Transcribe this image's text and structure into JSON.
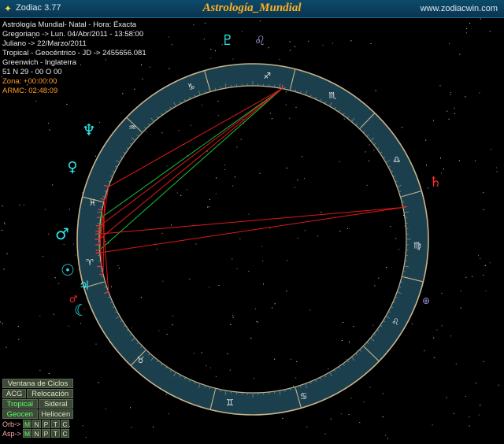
{
  "window": {
    "app_title": "Zodiac 3.77",
    "center_title": "Astrología_Mundial",
    "website": "www.zodiacwin.com"
  },
  "info_lines": [
    "Astrología Mundial- Natal - Hora: Exacta",
    "Gregoriano -> Lun. 04/Abr/2011 - 13:58:00",
    "Juliano -> 22/Marzo/2011",
    "Tropical - Geocéntrico - JD -> 2455656.081",
    "Greenwich - Inglaterra",
    "51 N 29 - 00 O 00",
    "Zona: +00:00:00",
    "ARMC: 02:48:09"
  ],
  "controls": {
    "ventana": "Ventana de Ciclos",
    "acg": "ACG",
    "relocacion": "Relocación",
    "tropical": "Tropical",
    "sideral": "Sideral",
    "geocen": "Geocen",
    "heliocen": "Heliocen",
    "orb_label": "Orb->",
    "asp_label": "Asp->",
    "toggles": [
      "M",
      "N",
      "P",
      "T",
      "C"
    ]
  },
  "signs": [
    {
      "name": "aries",
      "glyph": "♈"
    },
    {
      "name": "taurus",
      "glyph": "♉"
    },
    {
      "name": "gemini",
      "glyph": "♊"
    },
    {
      "name": "cancer",
      "glyph": "♋"
    },
    {
      "name": "leo",
      "glyph": "♌"
    },
    {
      "name": "virgo",
      "glyph": "♍"
    },
    {
      "name": "libra",
      "glyph": "♎"
    },
    {
      "name": "scorpio",
      "glyph": "♏"
    },
    {
      "name": "sagittarius",
      "glyph": "♐"
    },
    {
      "name": "capricorn",
      "glyph": "♑"
    },
    {
      "name": "aquarius",
      "glyph": "♒"
    },
    {
      "name": "pisces",
      "glyph": "♓"
    }
  ],
  "outer_symbols": [
    {
      "name": "pluto",
      "glyph": "♇",
      "color": "#2ee6e6"
    },
    {
      "name": "leo-outer",
      "glyph": "♌",
      "color": "#9b8fd8"
    },
    {
      "name": "neptune",
      "glyph": "♆",
      "color": "#2ee6e6"
    },
    {
      "name": "venus",
      "glyph": "♀",
      "color": "#2ee6e6"
    },
    {
      "name": "mars",
      "glyph": "♂",
      "color": "#2ee6e6"
    },
    {
      "name": "sun",
      "glyph": "☉",
      "color": "#2ee6e6"
    },
    {
      "name": "jupiter",
      "glyph": "♃",
      "color": "#2ee6e6"
    },
    {
      "name": "moon",
      "glyph": "☾",
      "color": "#2ee6e6"
    },
    {
      "name": "mars-red",
      "glyph": "♂",
      "color": "#ff2a2a"
    },
    {
      "name": "saturn",
      "glyph": "♄",
      "color": "#ff2a2a"
    },
    {
      "name": "part-fortune",
      "glyph": "⊕",
      "color": "#9b8fd8"
    }
  ],
  "colors": {
    "ring_fill": "#1b3f4d",
    "ring_line": "#c8b48a",
    "inner_bg": "#000000",
    "aspect_red": "#e01818",
    "aspect_green": "#16c23a"
  }
}
